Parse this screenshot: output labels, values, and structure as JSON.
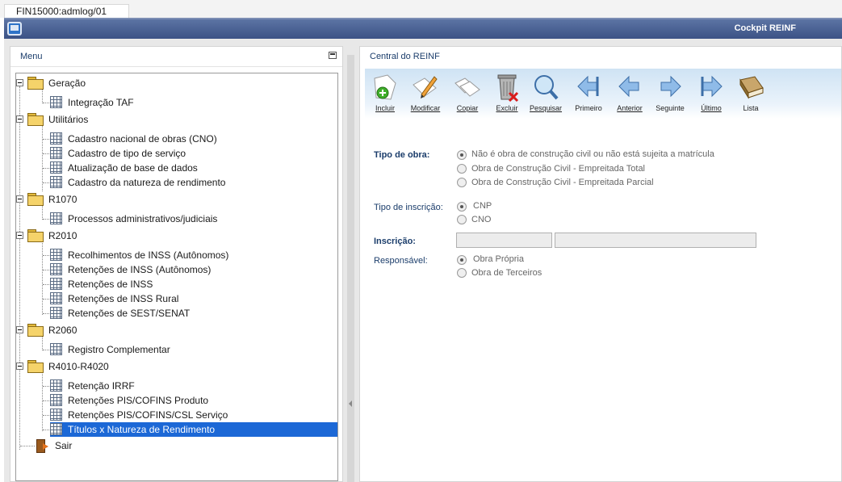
{
  "tab": {
    "label": "FIN15000:admlog/01"
  },
  "window": {
    "title": "Cockpit REINF"
  },
  "menu": {
    "title": "Menu",
    "groups": [
      {
        "label": "Geração",
        "items": [
          "Integração TAF"
        ]
      },
      {
        "label": "Utilitários",
        "items": [
          "Cadastro nacional de obras (CNO)",
          "Cadastro de tipo de serviço",
          "Atualização de base de dados",
          "Cadastro da natureza de rendimento"
        ]
      },
      {
        "label": "R1070",
        "items": [
          "Processos administrativos/judiciais"
        ]
      },
      {
        "label": "R2010",
        "items": [
          "Recolhimentos de INSS (Autônomos)",
          "Retenções de INSS (Autônomos)",
          "Retenções de INSS",
          "Retenções de INSS Rural",
          "Retenções de SEST/SENAT"
        ]
      },
      {
        "label": "R2060",
        "items": [
          "Registro Complementar"
        ]
      },
      {
        "label": "R4010-R4020",
        "items": [
          "Retenção IRRF",
          "Retenções PIS/COFINS Produto",
          "Retenções PIS/COFINS/CSL Serviço",
          "Títulos x Natureza de Rendimento"
        ]
      }
    ],
    "exit_label": "Sair",
    "selected_item": "Títulos x Natureza de Rendimento"
  },
  "content": {
    "title": "Central do REINF",
    "toolbar": [
      {
        "label": "Incluir",
        "icon": "add-icon"
      },
      {
        "label": "Modificar",
        "icon": "edit-icon"
      },
      {
        "label": "Copiar",
        "icon": "copy-icon"
      },
      {
        "label": "Excluir",
        "icon": "delete-icon"
      },
      {
        "label": "Pesquisar",
        "icon": "search-icon"
      },
      {
        "label": "Primeiro",
        "icon": "first-icon"
      },
      {
        "label": "Anterior",
        "icon": "previous-icon"
      },
      {
        "label": "Seguinte",
        "icon": "next-icon"
      },
      {
        "label": "Último",
        "icon": "last-icon"
      },
      {
        "label": "Lista",
        "icon": "list-icon"
      }
    ],
    "form": {
      "tipo_obra": {
        "label": "Tipo de obra:",
        "options": [
          "Não é obra de construção civil ou não está sujeita a matrícula",
          "Obra de Construção Civil - Empreitada Total",
          "Obra de Construção Civil - Empreitada Parcial"
        ],
        "selected": "Não é obra de construção civil ou não está sujeita a matrícula"
      },
      "tipo_inscricao": {
        "label": "Tipo de inscrição:",
        "options": [
          "CNP",
          "CNO"
        ],
        "selected": "CNP"
      },
      "inscricao": {
        "label": "Inscrição:",
        "value1": "",
        "value2": ""
      },
      "responsavel": {
        "label": "Responsável:",
        "options": [
          "Obra Própria",
          "Obra de Terceiros"
        ],
        "selected": "Obra Própria"
      }
    }
  },
  "colors": {
    "title_bar": "#3b5285",
    "selection": "#1c68d6",
    "label_blue": "#1b3d6b"
  }
}
